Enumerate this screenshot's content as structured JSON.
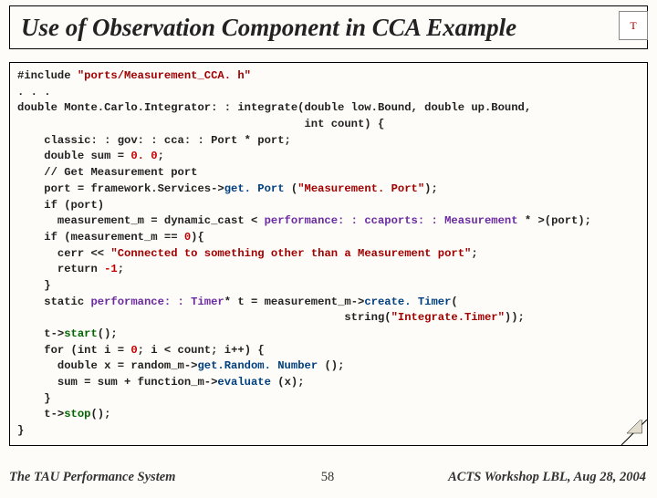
{
  "title": "Use of Observation Component in CCA Example",
  "logo_label": "T",
  "code": {
    "l01a": "#include ",
    "l01b": "\"ports/Measurement_CCA. h\"",
    "l02": ". . .",
    "l03": "double Monte.Carlo.Integrator: : integrate(double low.Bound, double up.Bound,",
    "l04": "                                           int count) {",
    "l05": "    classic: : gov: : cca: : Port * port;",
    "l06a": "    double sum = ",
    "l06b": "0. 0",
    "l06c": ";",
    "l07": "    // Get Measurement port",
    "l08a": "    port = framework.Services->",
    "l08b": "get. Port",
    "l08c": " (",
    "l08d": "\"Measurement. Port\"",
    "l08e": ");",
    "l09": "    if (port)",
    "l10a": "      measurement_m = dynamic_cast < ",
    "l10b": "performance: : ccaports: : Measurement",
    "l10c": " * >(port);",
    "l11a": "    if (measurement_m == ",
    "l11b": "0",
    "l11c": "){",
    "l12a": "      cerr << ",
    "l12b": "\"Connected to something other than a Measurement port\"",
    "l12c": ";",
    "l13a": "      return ",
    "l13b": "-1",
    "l13c": ";",
    "l14": "    }",
    "l15a": "    static ",
    "l15b": "performance: : Timer",
    "l15c": "* t = measurement_m->",
    "l15d": "create. Timer",
    "l15e": "(",
    "l16a": "                                                 string(",
    "l16b": "\"Integrate.Timer\"",
    "l16c": "));",
    "l17a": "    t->",
    "l17b": "start",
    "l17c": "();",
    "l18a": "    for (int i = ",
    "l18b": "0",
    "l18c": "; i < count; i++) {",
    "l19a": "      double x = random_m->",
    "l19b": "get.Random. Number",
    "l19c": " ();",
    "l20a": "      sum = sum + function_m->",
    "l20b": "evaluate",
    "l20c": " (x);",
    "l21": "    }",
    "l22a": "    t->",
    "l22b": "stop",
    "l22c": "();",
    "l23": "}"
  },
  "footer": {
    "left": "The TAU Performance System",
    "page": "58",
    "right": "ACTS Workshop LBL, Aug 28, 2004"
  }
}
